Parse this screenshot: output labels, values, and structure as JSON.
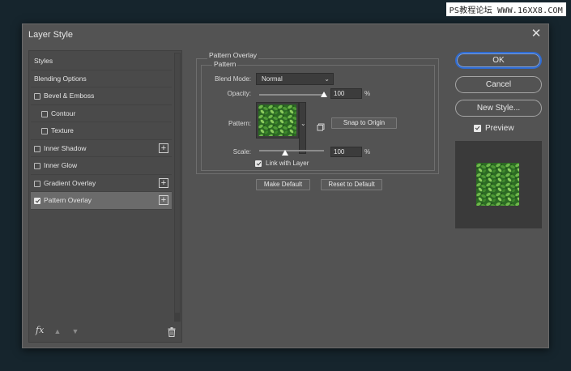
{
  "watermark": "PS教程论坛 WWW.16XX8.COM",
  "dialog": {
    "title": "Layer Style",
    "close_glyph": "✕"
  },
  "styles_panel": {
    "items": [
      {
        "label": "Styles",
        "has_checkbox": false,
        "checked": false,
        "indent": false,
        "has_plus": false,
        "active": false
      },
      {
        "label": "Blending Options",
        "has_checkbox": false,
        "checked": false,
        "indent": false,
        "has_plus": false,
        "active": false
      },
      {
        "label": "Bevel & Emboss",
        "has_checkbox": true,
        "checked": false,
        "indent": false,
        "has_plus": false,
        "active": false
      },
      {
        "label": "Contour",
        "has_checkbox": true,
        "checked": false,
        "indent": true,
        "has_plus": false,
        "active": false
      },
      {
        "label": "Texture",
        "has_checkbox": true,
        "checked": false,
        "indent": true,
        "has_plus": false,
        "active": false
      },
      {
        "label": "Inner Shadow",
        "has_checkbox": true,
        "checked": false,
        "indent": false,
        "has_plus": true,
        "active": false
      },
      {
        "label": "Inner Glow",
        "has_checkbox": true,
        "checked": false,
        "indent": false,
        "has_plus": false,
        "active": false
      },
      {
        "label": "Gradient Overlay",
        "has_checkbox": true,
        "checked": false,
        "indent": false,
        "has_plus": true,
        "active": false
      },
      {
        "label": "Pattern Overlay",
        "has_checkbox": true,
        "checked": true,
        "indent": false,
        "has_plus": true,
        "active": true
      }
    ],
    "footer": {
      "fx_label": "fx",
      "up_arrow": "▲",
      "down_arrow": "▼"
    }
  },
  "pattern_overlay": {
    "group_title": "Pattern Overlay",
    "sub_group_title": "Pattern",
    "blend_mode_label": "Blend Mode:",
    "blend_mode_value": "Normal",
    "opacity_label": "Opacity:",
    "opacity_value": "100",
    "opacity_level": 1.0,
    "pattern_label": "Pattern:",
    "snap_button": "Snap to Origin",
    "scale_label": "Scale:",
    "scale_value": "100",
    "scale_level": 0.4,
    "percent_unit": "%",
    "link_label": "Link with Layer",
    "link_checked": true,
    "make_default_button": "Make Default",
    "reset_default_button": "Reset to Default",
    "chevron": "⌄"
  },
  "right_panel": {
    "ok_button": "OK",
    "cancel_button": "Cancel",
    "new_style_button": "New Style...",
    "preview_label": "Preview",
    "preview_checked": true
  },
  "colors": {
    "accent": "#2f6bd0",
    "dialog_bg": "#535353",
    "background": "#16252d"
  }
}
